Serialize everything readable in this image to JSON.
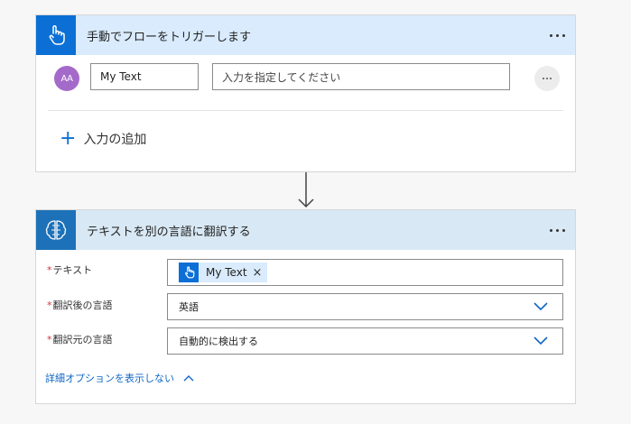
{
  "trigger_card": {
    "title": "手動でフローをトリガーします",
    "icon": "touch-hand-icon",
    "avatar_text": "AA",
    "input_name": "My Text",
    "input_placeholder": "入力を指定してください",
    "add_input_label": "入力の追加",
    "header_color": "#d9ebfc",
    "accent_color": "#0b6fd6"
  },
  "translate_card": {
    "title": "テキストを別の言語に翻訳する",
    "icon": "brain-icon",
    "header_color": "#d8e8f4",
    "fields": {
      "text_label": "テキスト",
      "text_token": "My Text",
      "target_label": "翻訳後の言語",
      "target_value": "英語",
      "source_label": "翻訳元の言語",
      "source_value": "自動的に検出する"
    },
    "required_marker": "*",
    "advanced_label": "詳細オプションを表示しない"
  }
}
